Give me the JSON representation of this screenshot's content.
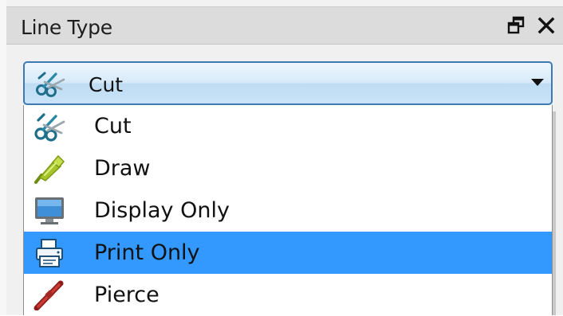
{
  "panel": {
    "title": "Line Type",
    "float_icon": "restore-window-icon",
    "close_icon": "close-icon"
  },
  "combo": {
    "selected_label": "Cut",
    "selected_icon": "scissors-icon",
    "arrow_icon": "dropdown-arrow-icon"
  },
  "dropdown": {
    "items": [
      {
        "label": "Cut",
        "icon": "scissors-icon",
        "selected": false
      },
      {
        "label": "Draw",
        "icon": "pen-icon",
        "selected": false
      },
      {
        "label": "Display Only",
        "icon": "monitor-icon",
        "selected": false
      },
      {
        "label": "Print Only",
        "icon": "printer-icon",
        "selected": true
      },
      {
        "label": "Pierce",
        "icon": "pierce-icon",
        "selected": false
      }
    ]
  },
  "colors": {
    "highlight": "#3399ff",
    "combo_border": "#3d7ab3",
    "titlebar": "#dcdcdc"
  }
}
